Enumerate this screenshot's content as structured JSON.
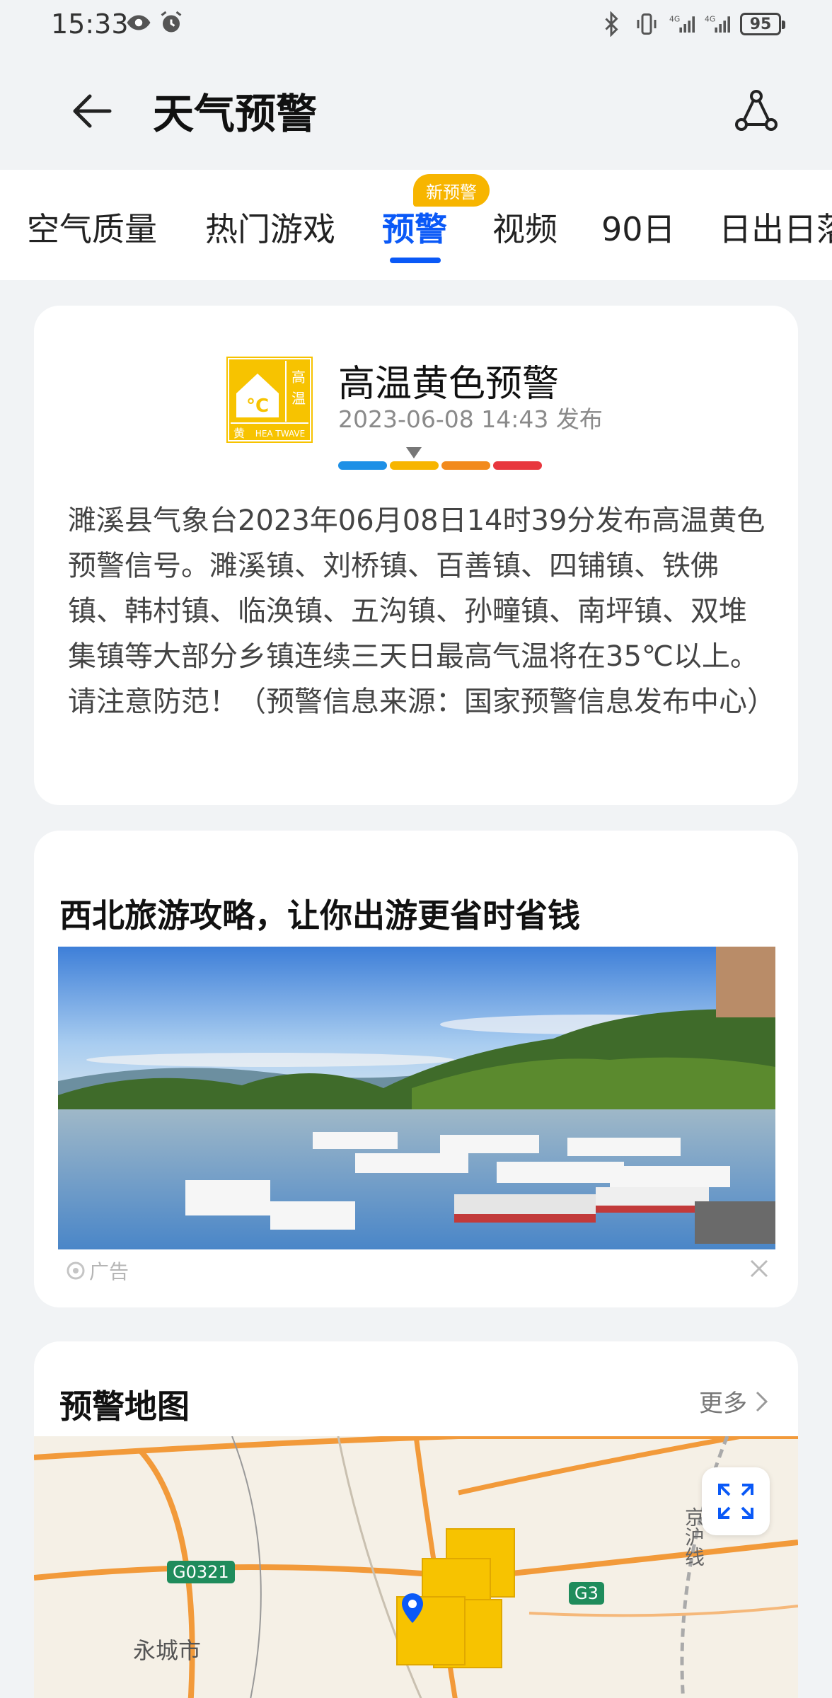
{
  "status": {
    "time": "15:33",
    "battery": "95",
    "net1": "4G",
    "net2": "4G"
  },
  "header": {
    "title": "天气预警"
  },
  "tabs": [
    {
      "label": "空气质量"
    },
    {
      "label": "热门游戏"
    },
    {
      "label": "预警"
    },
    {
      "label": "视频"
    },
    {
      "label": "90日"
    },
    {
      "label": "日出日落"
    }
  ],
  "tab_badge": "新预警",
  "warning": {
    "icon_text_top": "高",
    "icon_text_mid": "温",
    "icon_unit": "°C",
    "icon_level": "黄",
    "icon_en": "HEA TWAVE",
    "title": "高温黄色预警",
    "time": "2023-06-08 14:43 发布",
    "description": "濉溪县气象台2023年06月08日14时39分发布高温黄色预警信号。濉溪镇、刘桥镇、百善镇、四铺镇、铁佛镇、韩村镇、临涣镇、五沟镇、孙疃镇、南坪镇、双堆集镇等大部分乡镇连续三天日最高气温将在35℃以上。请注意防范！（预警信息来源：国家预警信息发布中心）",
    "levels": [
      "#1e90e6",
      "#f7b500",
      "#f28a1d",
      "#e8373e"
    ]
  },
  "ad": {
    "title": "西北旅游攻略，让你出游更省时省钱",
    "tag": "广告"
  },
  "map": {
    "title": "预警地图",
    "more": "更多",
    "roads": [
      "G0321",
      "G3"
    ],
    "city": "永城市",
    "rail": "京沪线"
  }
}
